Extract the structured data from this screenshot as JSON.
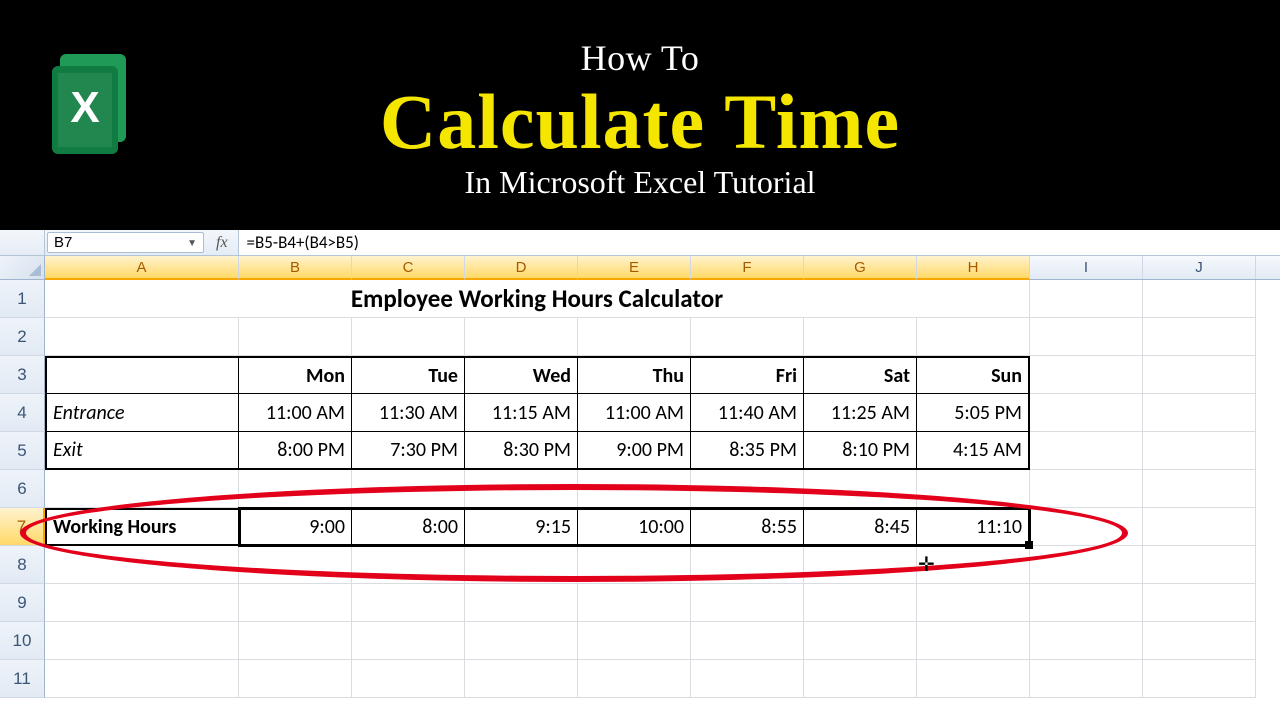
{
  "banner": {
    "howto": "How To",
    "title": "Calculate Time",
    "sub": "In Microsoft Excel Tutorial"
  },
  "fbar": {
    "namebox": "B7",
    "fx": "fx",
    "formula": "=B5-B4+(B4>B5)"
  },
  "columns": [
    "A",
    "B",
    "C",
    "D",
    "E",
    "F",
    "G",
    "H",
    "I",
    "J"
  ],
  "rows": [
    "1",
    "2",
    "3",
    "4",
    "5",
    "6",
    "7",
    "8",
    "9",
    "10",
    "11"
  ],
  "sheet": {
    "title": "Employee Working Hours Calculator",
    "days": [
      "Mon",
      "Tue",
      "Wed",
      "Thu",
      "Fri",
      "Sat",
      "Sun"
    ],
    "entrance_label": "Entrance",
    "entrance": [
      "11:00 AM",
      "11:30 AM",
      "11:15 AM",
      "11:00 AM",
      "11:40 AM",
      "11:25 AM",
      "5:05 PM"
    ],
    "exit_label": "Exit",
    "exit": [
      "8:00 PM",
      "7:30 PM",
      "8:30 PM",
      "9:00 PM",
      "8:35 PM",
      "8:10 PM",
      "4:15 AM"
    ],
    "working_label": "Working Hours",
    "working": [
      "9:00",
      "8:00",
      "9:15",
      "10:00",
      "8:55",
      "8:45",
      "11:10"
    ]
  }
}
